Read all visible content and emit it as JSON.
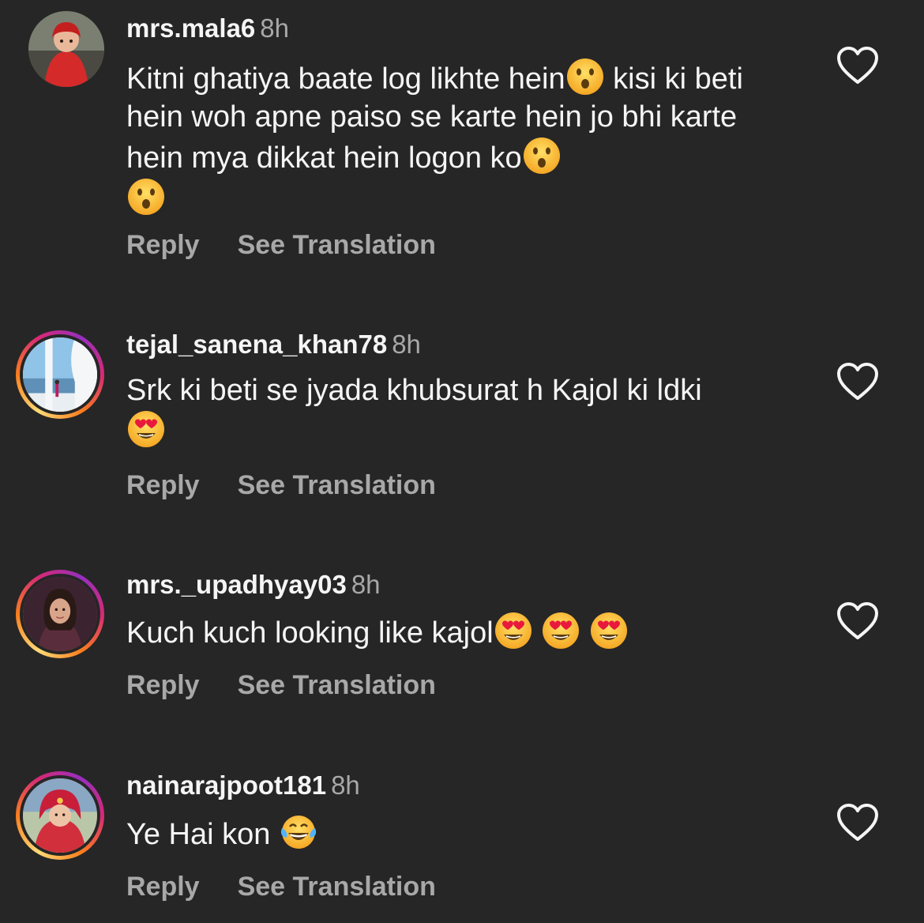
{
  "comments": [
    {
      "username": "mrs.mala6",
      "time": "8h",
      "text_parts": [
        "Kitni ghatiya baate log likhte hein",
        "kisi ki beti hein woh apne paiso se karte hein jo bhi karte hein mya dikkat hein logon ko"
      ],
      "emojis": [
        "hushed-face",
        "hushed-face",
        "hushed-face"
      ],
      "avatar_ring": false,
      "reply_label": "Reply",
      "translate_label": "See Translation"
    },
    {
      "username": "tejal_sanena_khan78",
      "time": "8h",
      "text_parts": [
        "Srk ki beti se jyada khubsurat h Kajol ki ldki"
      ],
      "emojis": [
        "heart-eyes"
      ],
      "avatar_ring": true,
      "reply_label": "Reply",
      "translate_label": "See Translation"
    },
    {
      "username": "mrs._upadhyay03",
      "time": "8h",
      "text_parts": [
        "Kuch kuch looking like kajol"
      ],
      "emojis": [
        "heart-eyes",
        "heart-eyes",
        "heart-eyes"
      ],
      "avatar_ring": true,
      "reply_label": "Reply",
      "translate_label": "See Translation"
    },
    {
      "username": "nainarajpoot181",
      "time": "8h",
      "text_parts": [
        "Ye Hai kon"
      ],
      "emojis": [
        "tears-of-joy"
      ],
      "avatar_ring": true,
      "reply_label": "Reply",
      "translate_label": "See Translation"
    }
  ],
  "icons": {
    "like": "heart-outline-icon"
  },
  "colors": {
    "background": "#262626",
    "primary_text": "#f5f5f5",
    "secondary_text": "#a8a8a8"
  }
}
